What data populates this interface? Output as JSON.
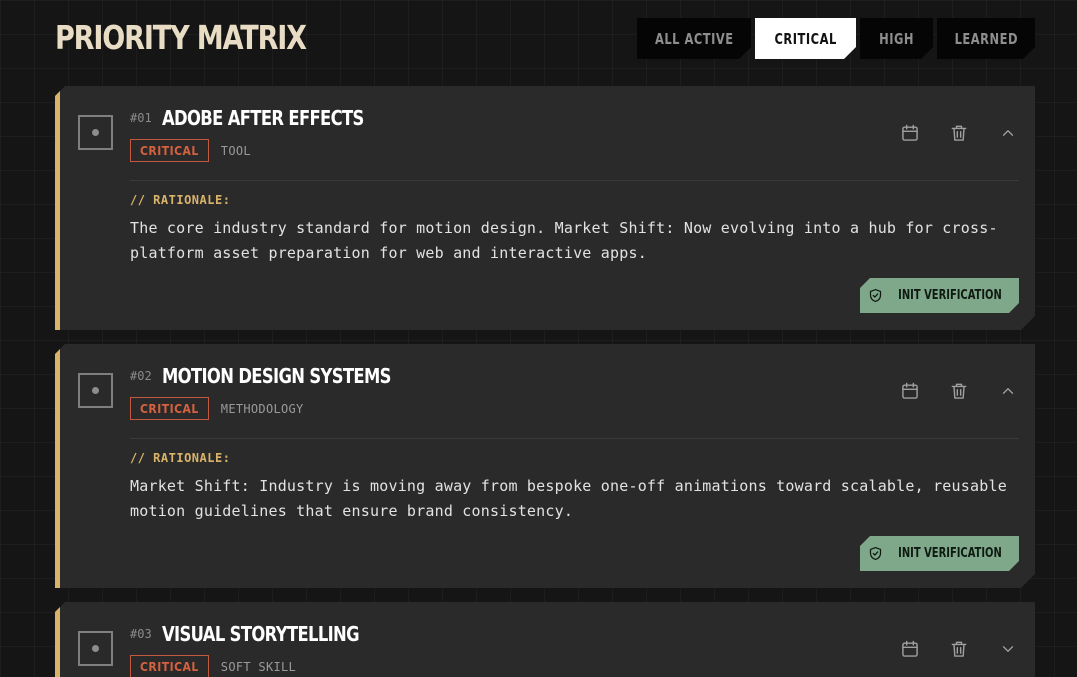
{
  "header": {
    "title": "PRIORITY MATRIX"
  },
  "filters": [
    {
      "label": "ALL ACTIVE",
      "active": false
    },
    {
      "label": "CRITICAL",
      "active": true
    },
    {
      "label": "HIGH",
      "active": false
    },
    {
      "label": "LEARNED",
      "active": false
    }
  ],
  "colors": {
    "accent": "#d9b36a",
    "critical": "#d4613f",
    "verify": "#7fa88a",
    "card_bg": "#2a2a2a",
    "page_bg": "#151515"
  },
  "cards": [
    {
      "num": "#01",
      "title": "ADOBE AFTER EFFECTS",
      "priority": "CRITICAL",
      "category": "TOOL",
      "expanded": true,
      "rationale_label": "// RATIONALE:",
      "rationale": "The core industry standard for motion design. Market Shift: Now evolving into a hub for cross-platform asset preparation for web and interactive apps.",
      "verify_label": "INIT VERIFICATION"
    },
    {
      "num": "#02",
      "title": "MOTION DESIGN SYSTEMS",
      "priority": "CRITICAL",
      "category": "METHODOLOGY",
      "expanded": true,
      "rationale_label": "// RATIONALE:",
      "rationale": "Market Shift: Industry is moving away from bespoke one-off animations toward scalable, reusable motion guidelines that ensure brand consistency.",
      "verify_label": "INIT VERIFICATION"
    },
    {
      "num": "#03",
      "title": "VISUAL STORYTELLING",
      "priority": "CRITICAL",
      "category": "SOFT SKILL",
      "expanded": false
    }
  ],
  "icons": {
    "calendar": "calendar-icon",
    "delete": "trash-icon",
    "collapse": "chevron-up-icon",
    "expand": "chevron-down-icon",
    "verify": "shield-check-icon"
  }
}
